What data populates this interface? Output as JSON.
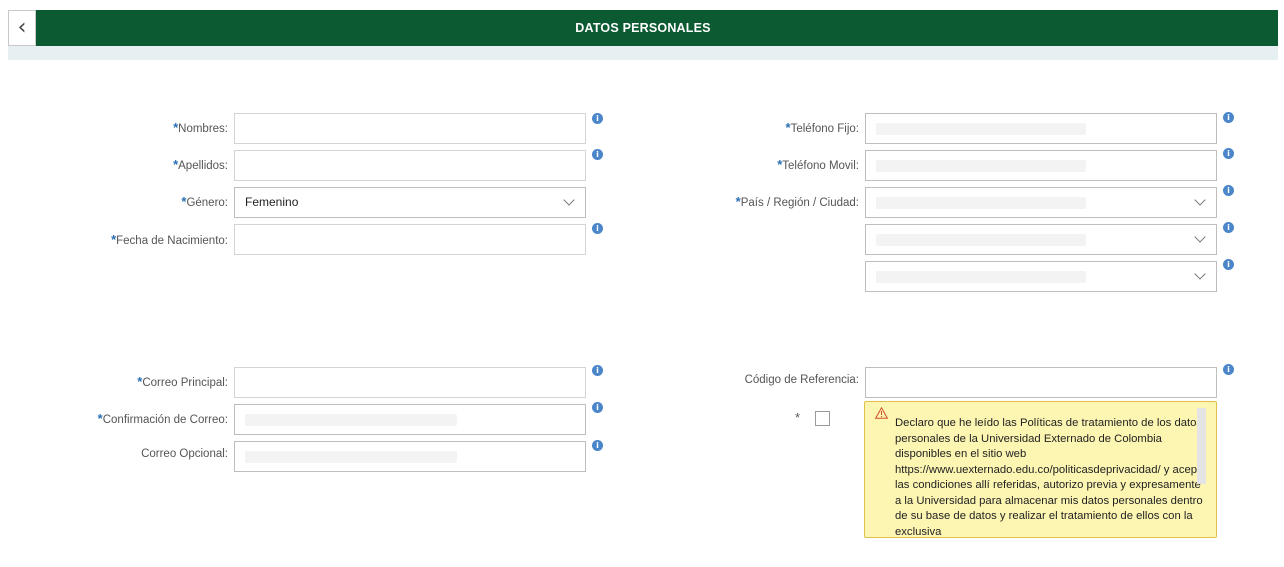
{
  "header": {
    "title": "DATOS PERSONALES",
    "back_icon": "chevron-left-icon"
  },
  "left": {
    "nombres": {
      "label": "Nombres:",
      "required": "*",
      "value": ""
    },
    "apellidos": {
      "label": "Apellidos:",
      "required": "*",
      "value": ""
    },
    "genero": {
      "label": "Género:",
      "required": "*",
      "value": "Femenino"
    },
    "fecha": {
      "label": "Fecha de Nacimiento:",
      "required": "*",
      "value": ""
    },
    "correo_principal": {
      "label": "Correo Principal:",
      "required": "*",
      "value": ""
    },
    "confirmacion": {
      "label": "Confirmación de Correo:",
      "required": "*",
      "value": ""
    },
    "correo_opcional": {
      "label": "Correo Opcional:",
      "value": ""
    }
  },
  "right": {
    "telefono_fijo": {
      "label": "Teléfono Fijo:",
      "required": "*",
      "value": ""
    },
    "telefono_movil": {
      "label": "Teléfono Movil:",
      "required": "*",
      "value": ""
    },
    "ubicacion": {
      "label": "País / Región / Ciudad:",
      "required": "*",
      "pais": "",
      "region": "",
      "ciudad": ""
    },
    "codigo": {
      "label": "Código de Referencia:",
      "value": ""
    }
  },
  "consent": {
    "required": "*",
    "checked": false,
    "icon": "warning-icon",
    "text": "Declaro que he leído las Políticas de tratamiento de los datos personales de la Universidad Externado de Colombia disponibles en el sitio web https://www.uexternado.edu.co/politicasdeprivacidad/ y acepto las condiciones allí referidas, autorizo previa y expresamente a la Universidad para almacenar mis datos personales dentro de su base de datos y realizar el tratamiento de ellos con la exclusiva"
  },
  "info_icon": "i",
  "colors": {
    "header_bg": "#0b5a32",
    "accent_blue": "#4a86c9",
    "consent_bg": "#fdf6b3",
    "consent_border": "#e0c24a"
  }
}
